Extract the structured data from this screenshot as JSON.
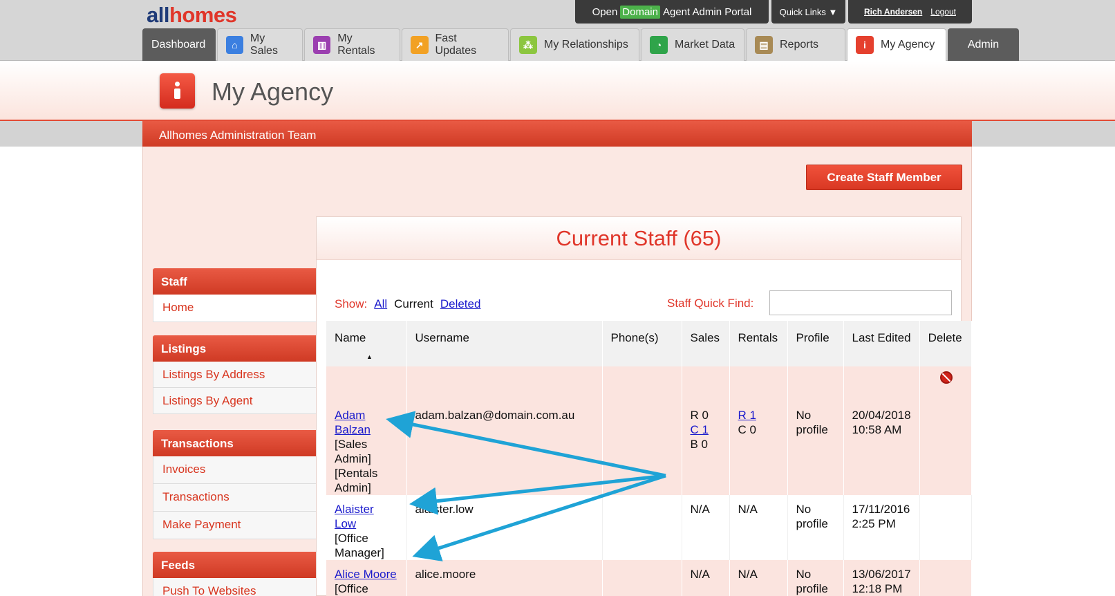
{
  "brand": {
    "logo_all": "all",
    "logo_homes": "homes"
  },
  "top_bar": {
    "portal_prefix": "Open",
    "portal_brand": "Domain",
    "portal_suffix": "Agent Admin Portal",
    "quick_links": "Quick Links ▼",
    "user_name": "Rich Andersen",
    "logout": "Logout"
  },
  "tabs": [
    {
      "label": "Dashboard",
      "icon": "dashboard"
    },
    {
      "label": "My Sales",
      "icon": "home-icon"
    },
    {
      "label": "My Rentals",
      "icon": "building-icon"
    },
    {
      "label": "Fast Updates",
      "icon": "lightning-icon"
    },
    {
      "label": "My Relationships",
      "icon": "network-icon"
    },
    {
      "label": "Market Data",
      "icon": "pie-chart-icon"
    },
    {
      "label": "Reports",
      "icon": "report-icon"
    },
    {
      "label": "My Agency",
      "icon": "agency-icon",
      "active": true
    },
    {
      "label": "Admin"
    }
  ],
  "page": {
    "title": "My Agency",
    "team_name": "Allhomes Administration Team",
    "create_button": "Create Staff Member"
  },
  "sidebar": [
    {
      "heading": "Staff",
      "items": [
        "Home"
      ]
    },
    {
      "heading": "Listings",
      "items": [
        "Listings By Address",
        "Listings By Agent"
      ]
    },
    {
      "heading": "Transactions",
      "items": [
        "Invoices",
        "Transactions",
        "Make Payment"
      ]
    },
    {
      "heading": "Feeds",
      "items": [
        "Push To Websites"
      ]
    }
  ],
  "staff": {
    "title": "Current Staff (65)",
    "show_label": "Show:",
    "filters": {
      "all": "All",
      "current": "Current",
      "deleted": "Deleted"
    },
    "quick_find_label": "Staff Quick Find:",
    "quick_find_value": "",
    "columns": [
      "Name",
      "Username",
      "Phone(s)",
      "Sales",
      "Rentals",
      "Profile",
      "Last Edited",
      "Delete"
    ],
    "rows": [
      {
        "name": "Adam Balzan",
        "roles": "[Sales Admin] [Rentals Admin]",
        "username": "adam.balzan@domain.com.au",
        "phones": "",
        "sales": [
          "R 0",
          "C 1",
          "B 0"
        ],
        "rentals": [
          "R 1",
          "C 0"
        ],
        "profile": "No profile",
        "last_edited": "20/04/2018 10:58 AM"
      },
      {
        "name": "Alaister Low",
        "roles": "[Office Manager]",
        "username": "alaister.low",
        "phones": "",
        "sales": "N/A",
        "rentals": "N/A",
        "profile": "No profile",
        "last_edited": "17/11/2016 2:25 PM"
      },
      {
        "name": "Alice Moore",
        "roles": "[Office Manager]",
        "username": "alice.moore",
        "phones": "",
        "sales": "N/A",
        "rentals": "N/A",
        "profile": "No profile",
        "last_edited": "13/06/2017 12:18 PM"
      }
    ]
  },
  "colors": {
    "accent_red": "#e0362a",
    "link_blue": "#1a1acc",
    "arrow_blue": "#1fa3d6",
    "row_pink": "#fbe4df"
  }
}
